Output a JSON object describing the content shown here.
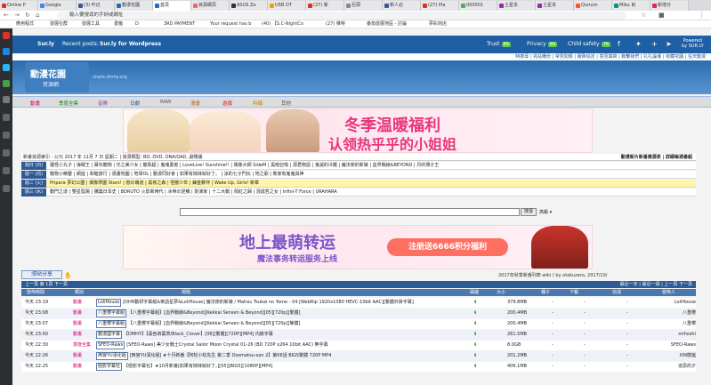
{
  "browser": {
    "tabs": [
      {
        "label": "Online P",
        "color": "#e1302b"
      },
      {
        "label": "Google",
        "color": "#4285f4"
      },
      {
        "label": "(3) 叶记",
        "color": "#3b5998"
      },
      {
        "label": "動漫花園",
        "color": "#2a6cae"
      },
      {
        "label": "首頁",
        "color": "#2a6cae"
      },
      {
        "label": "資源網頁",
        "color": "#e66"
      },
      {
        "label": "ASUS Ze",
        "color": "#333"
      },
      {
        "label": "USB OT",
        "color": "#f90"
      },
      {
        "label": "(27) 新",
        "color": "#e1302b"
      },
      {
        "label": "巨頭",
        "color": "#888"
      },
      {
        "label": "新人必",
        "color": "#3b5998"
      },
      {
        "label": "(27) Pla",
        "color": "#e1302b"
      },
      {
        "label": "000001",
        "color": "#4caf50"
      },
      {
        "label": "土星本",
        "color": "#9c27b0"
      },
      {
        "label": "土星本",
        "color": "#9c27b0"
      },
      {
        "label": "Quirum",
        "color": "#ff5722"
      },
      {
        "label": "Miku 目",
        "color": "#009688"
      },
      {
        "label": "新增分",
        "color": "#e91e63"
      }
    ],
    "url": "share.dmhy.org",
    "url_hint": "輸入要搜尋的字詞或網址",
    "bookmarks": [
      "應用程式",
      "發展社群",
      "發展工具",
      "書籤",
      "D",
      "3RD PAYMENT",
      "Your request has b",
      "(40) 【S.C-NightCo",
      "(27) 推特",
      "番茄發展地區 - 討論",
      "夢彩商店"
    ]
  },
  "sharebar": {
    "brand": "Sur.ly",
    "recent_label": "Recent posts:",
    "recent_link": "Sur.ly for Wordpress",
    "trust_label": "Trust",
    "trust_value": "89",
    "privacy_label": "Privacy",
    "privacy_value": "89",
    "safety_label": "Child safety",
    "safety_value": "76",
    "powered1": "Powered",
    "powered2": "by SUR.LY"
  },
  "site": {
    "toplinks": "特搜尋 | 完站備份 | 常見問題 | 服務協定 | 意見填寫 | 聯繫我們 | 扎扎論壇 | 收藏花園 | 任天動漫",
    "logo_title": "動漫花園",
    "logo_sub": "資源網",
    "domain": "share.dmhy.org",
    "menus": [
      "動畫",
      "季度全集",
      "音樂",
      "日劇",
      "RAW",
      "漫畫",
      "遊戲",
      "特攝",
      "其他"
    ]
  },
  "banner1": {
    "line1": "冬季温暖福利",
    "line2": "认领热乎乎的小姐姐"
  },
  "schedule": {
    "header": "新番資源索引 - 公元 2017 年 11月 7 日 星期二 | 資源類型: BD, DVD, ONA/OAD, 劇場版",
    "header_right": "動漫新片新番資源表 | 詳細每週番組",
    "rows": [
      {
        "day": "週日 (日)",
        "items": "擾怪小丸子 | 海賊王 | 寶石寵物 | 光之美少女 | 龍珠超 | 鬼魂勇者 | LoveLive! Sunshine!! | 偶像大師 SideM | 黑暗召喚 | 源君物語 | 鬼滅的冷鐵 | 魔法使的新娘 | 血界戰線&BEYOND | 月的傳子王"
      },
      {
        "day": "週一 (月)",
        "items": "寵物小精靈 | 網遊 | 和睦旅行 | 漫畫地圖 | 地球OL | 動漫同好會 | 如果有妹妹就好了。 | 涼的七子門伝 | 地之歌 | 敗家有鬼鬼與神"
      },
      {
        "day": "週二 (火)",
        "items": "Pripara 夢幻公園 | 偶像學園 Stars! | 戀の萌道 | 黑夜之森 | 怪獸少年 | 鍊金夥伴 | Wake Up, Girls! 新章"
      },
      {
        "day": "週三 (水)",
        "items": "動門之達 | 雙星陰陽 | 攜築日本史 | BORUTO 火影新時代 | 冰帝の逆鱗 | 劍演家 | 十二大戰 | 佩紅之歸 | 混成哲之女 | Infini-T Force | URAHARA"
      }
    ]
  },
  "search": {
    "placeholder": "",
    "button": "搜尋",
    "advanced": "高級"
  },
  "banner2": {
    "line1": "地上最萌转运",
    "line2": "魔法事务转运服务上线",
    "cta": "注册送6666积分福利"
  },
  "list": {
    "share_button": "漲貼分享",
    "info": "2017年秋季新番列表-wiki ( by otakuzero, 2017/10/",
    "pager_left": "上一頁 第 1頁 下一頁",
    "pager_right": "最近一天 | 最近一週 | 上一頁 下一頁",
    "columns": [
      "發佈時間",
      "類別",
      "標題",
      "磁鏈",
      "大小",
      "種子",
      "下載",
      "完成",
      "發佈人"
    ],
    "rows": [
      {
        "time": "今天 23:19",
        "cat": "動畫",
        "team": "LoliHouse",
        "title": "[DHR動研字幕組&茉語星夢&LoliHouse] 魔法使的新娘 / Mahou Tsukai no Yome - 04 [WebRip 1920x1080 HEVC-10bit AAC][繁體外掛字幕]",
        "size": "379.8MB",
        "seed": "-",
        "dl": "-",
        "done": "-",
        "user": "LoliHouse"
      },
      {
        "time": "今天 23:08",
        "cat": "動畫",
        "team": "八重櫻字幕組",
        "title": "【八重櫻字幕組】[血界戰線&Beyond][Kekkai Sensen & Beyond][05][720p][繁體]",
        "size": "200.4MB",
        "seed": "-",
        "dl": "-",
        "done": "-",
        "user": "八重櫻"
      },
      {
        "time": "今天 23:07",
        "cat": "動畫",
        "team": "八重櫻字幕組",
        "title": "【八重櫻字幕組】[血界戰線&Beyond][Kekkai Sensen & Beyond][05][720p][簡體]",
        "size": "200.4MB",
        "seed": "-",
        "dl": "-",
        "done": "-",
        "user": "八重櫻"
      },
      {
        "time": "今天 23:00",
        "cat": "動畫",
        "team": "動漫國字幕",
        "title": "【DMHY】【黑色四葉草/Black_Clover】[06][繁體][720P][MP4] 内嵌字幕",
        "size": "261.5MB",
        "seed": "-",
        "dl": "-",
        "done": "-",
        "user": "mihoshi"
      },
      {
        "time": "今天 22:30",
        "cat": "季度全集",
        "team": "SFEO-Raws",
        "title": "[SFEO-Raws] 美少女戰士Crystal Sailor Moon Crystal 01-26 (BD 720P x264 10bit AAC) 無字幕",
        "size": "8.0GB",
        "seed": "-",
        "dl": "-",
        "done": "-",
        "user": "SFEO-Raws"
      },
      {
        "time": "今天 22:26",
        "cat": "動畫",
        "team": "西宮YU漢化組",
        "title": "[西宮YU漢化組] ★十月新番【阿松小松先生 第二季 Osomatsu-san 2】第06話 BIG5繁體 720P MP4",
        "size": "201.2MB",
        "seed": "-",
        "dl": "-",
        "done": "-",
        "user": "XIN樹嵐"
      },
      {
        "time": "今天 22:25",
        "cat": "動畫",
        "team": "極影字幕社",
        "title": "【極影字幕社】★10月新番[如果有妹妹就好了。][05][BIG5][1080P][MP4]",
        "size": "406.1MB",
        "seed": "-",
        "dl": "-",
        "done": "-",
        "user": "追思的夕"
      }
    ]
  }
}
